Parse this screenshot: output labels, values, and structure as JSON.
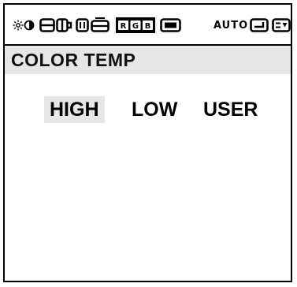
{
  "toolbar": {
    "icons": [
      {
        "name": "brightness-contrast-icon",
        "active": false
      },
      {
        "name": "position-icon",
        "active": false
      },
      {
        "name": "size-icon",
        "active": false
      },
      {
        "name": "rgb-icon",
        "label": "RGB",
        "active": true
      },
      {
        "name": "screen-icon",
        "active": false
      },
      {
        "name": "auto-label",
        "label": "AUTO",
        "active": false
      },
      {
        "name": "input-icon",
        "active": false
      },
      {
        "name": "osd-icon",
        "active": false
      }
    ],
    "auto_label": "AUTO",
    "rgb_label": "RGB"
  },
  "title": "COLOR TEMP",
  "options": [
    {
      "label": "HIGH",
      "selected": true
    },
    {
      "label": "LOW",
      "selected": false
    },
    {
      "label": "USER",
      "selected": false
    }
  ],
  "colors": {
    "background": "#ffffff",
    "highlight": "#e6e6e6",
    "ink": "#000000"
  }
}
